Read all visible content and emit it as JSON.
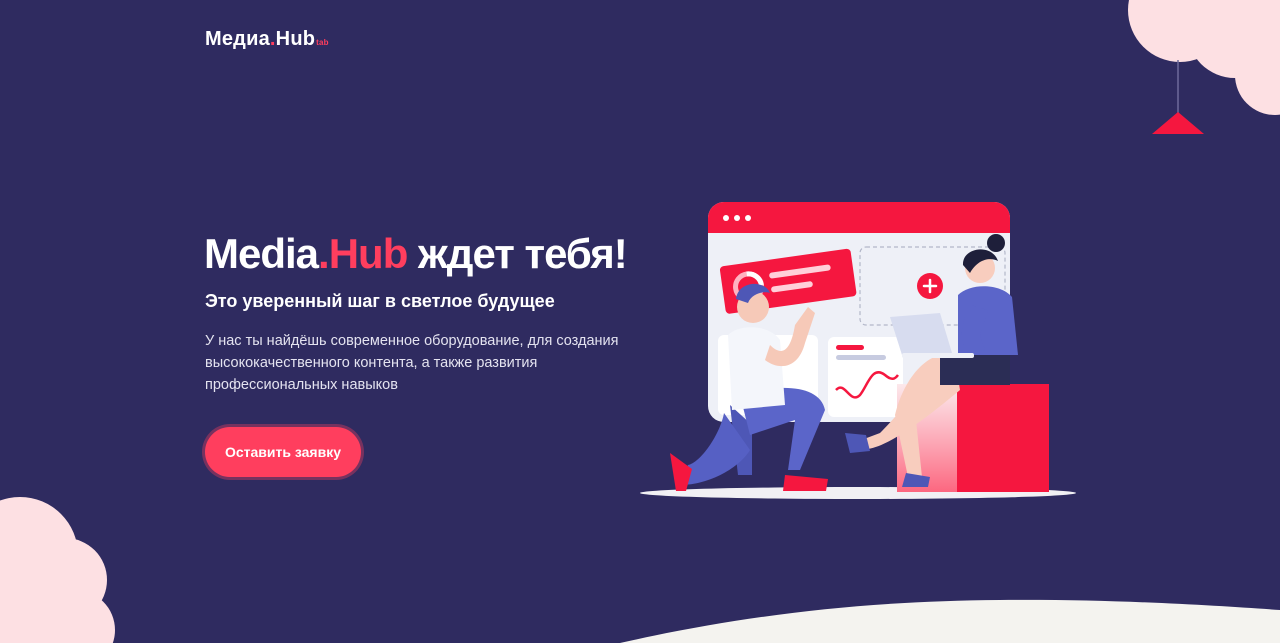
{
  "header": {
    "logo": {
      "part1": "Медиа",
      "dot": ".",
      "part2": "Hub",
      "badge": "tab"
    }
  },
  "hero": {
    "title": {
      "brand_left": "Media",
      "dot": ".",
      "brand_right": "Hub",
      "rest": " ждет тебя!"
    },
    "subtitle": "Это уверенный шаг в светлое будущее",
    "description": "У нас ты найдёшь современное оборудование, для создания высококачественного контента, а также развития профессиональных навыков",
    "cta_label": "Оставить заявку"
  },
  "colors": {
    "background": "#2f2b60",
    "accent": "#ff3e5e",
    "cloud": "#fde0e3",
    "floor": "#f4f3ef"
  }
}
